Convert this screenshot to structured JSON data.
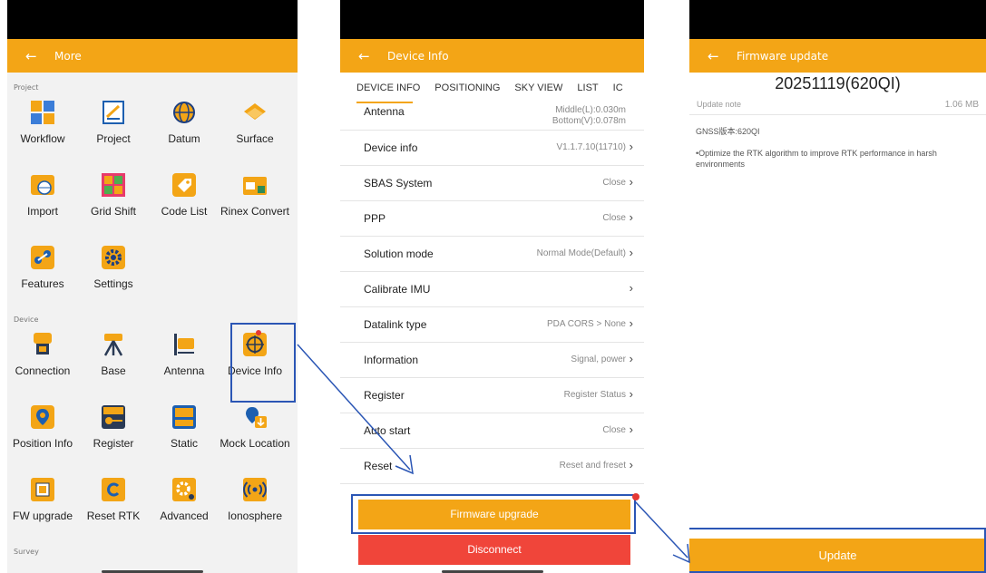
{
  "colors": {
    "accent": "#f3a516",
    "disconnect": "#f0453a",
    "callout": "#2b56b5",
    "badge": "#e53935"
  },
  "more": {
    "header": "More",
    "sections": {
      "project": "Project",
      "device": "Device",
      "survey": "Survey"
    },
    "tiles": {
      "workflow": "Workflow",
      "project": "Project",
      "datum": "Datum",
      "surface": "Surface",
      "import": "Import",
      "grid_shift": "Grid Shift",
      "code_list": "Code List",
      "rinex_convert": "Rinex Convert",
      "features": "Features",
      "settings": "Settings",
      "connection": "Connection",
      "base": "Base",
      "antenna": "Antenna",
      "device_info": "Device Info",
      "position_info": "Position Info",
      "register": "Register",
      "static": "Static",
      "mock_location": "Mock Location",
      "fw_upgrade": "FW upgrade",
      "reset_rtk": "Reset RTK",
      "advanced": "Advanced",
      "ionosphere": "Ionosphere"
    }
  },
  "device_info": {
    "header": "Device Info",
    "tabs": [
      "DEVICE INFO",
      "POSITIONING",
      "SKY VIEW",
      "LIST",
      "IC"
    ],
    "antenna": {
      "label": "Antenna",
      "value1": "Middle(L):0.030m",
      "value2": "Bottom(V):0.078m"
    },
    "rows": [
      {
        "label": "Device info",
        "value": "V1.1.7.10(11710)"
      },
      {
        "label": "SBAS System",
        "value": "Close"
      },
      {
        "label": "PPP",
        "value": "Close"
      },
      {
        "label": "Solution mode",
        "value": "Normal Mode(Default)"
      },
      {
        "label": "Calibrate IMU",
        "value": ""
      },
      {
        "label": "Datalink type",
        "value": "PDA CORS > None"
      },
      {
        "label": "Information",
        "value": "Signal, power"
      },
      {
        "label": "Register",
        "value": "Register Status"
      },
      {
        "label": "Auto start",
        "value": "Close"
      },
      {
        "label": "Reset",
        "value": "Reset and freset"
      }
    ],
    "firmware_button": "Firmware upgrade",
    "disconnect_button": "Disconnect"
  },
  "firmware": {
    "header": "Firmware update",
    "version": "20251119(620QI)",
    "update_note_label": "Update note",
    "size": "1.06 MB",
    "gnss_line": "GNSS版本:620QI",
    "description": "•Optimize the RTK algorithm to improve RTK performance in harsh environments",
    "update_button": "Update"
  }
}
